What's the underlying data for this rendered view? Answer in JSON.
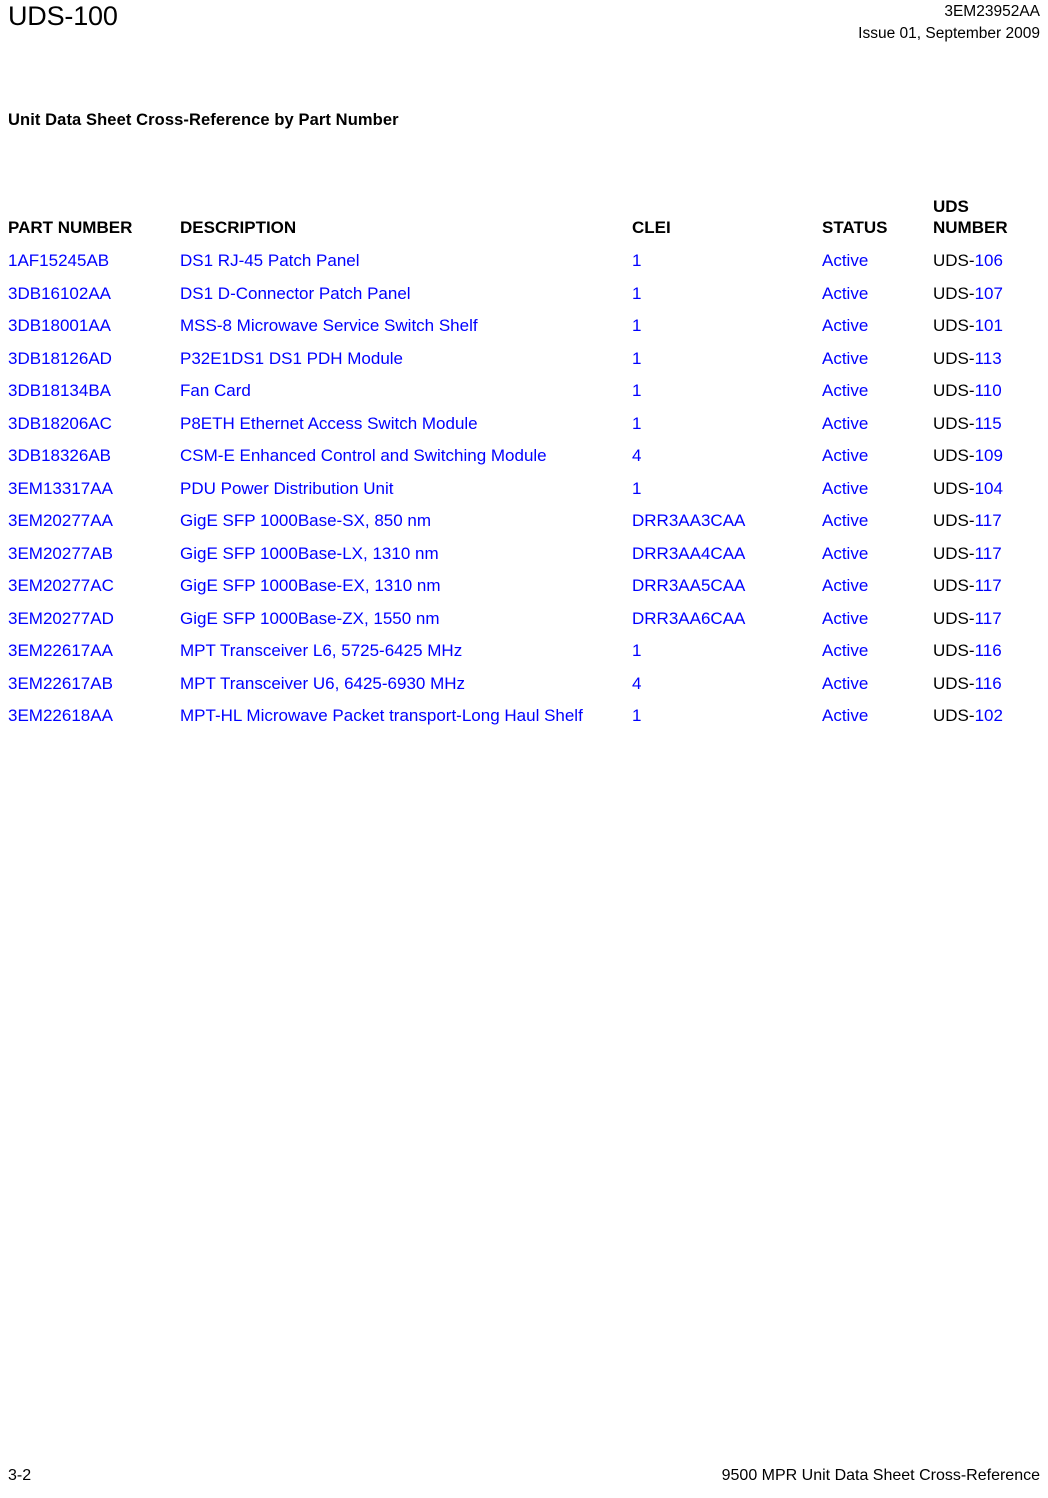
{
  "header": {
    "doc_label": "UDS-100",
    "part_number": "3EM23952AA",
    "issue": "Issue 01, September 2009"
  },
  "section": {
    "title": "Unit Data Sheet Cross-Reference by Part Number"
  },
  "table": {
    "columns": {
      "part_number": "PART NUMBER",
      "description": "DESCRIPTION",
      "clei": "CLEI",
      "status": "STATUS",
      "uds_number": "UDS\nNUMBER"
    },
    "uds_prefix": "UDS-",
    "rows": [
      {
        "part_number": "1AF15245AB",
        "description": "DS1 RJ-45 Patch Panel",
        "clei": "1",
        "status": "Active",
        "uds_number": "106"
      },
      {
        "part_number": "3DB16102AA",
        "description": "DS1 D-Connector Patch Panel",
        "clei": "1",
        "status": "Active",
        "uds_number": "107"
      },
      {
        "part_number": "3DB18001AA",
        "description": "MSS-8 Microwave Service Switch Shelf",
        "clei": "1",
        "status": "Active",
        "uds_number": "101"
      },
      {
        "part_number": "3DB18126AD",
        "description": "P32E1DS1 DS1 PDH Module",
        "clei": "1",
        "status": "Active",
        "uds_number": "113"
      },
      {
        "part_number": "3DB18134BA",
        "description": "Fan Card",
        "clei": "1",
        "status": "Active",
        "uds_number": "110"
      },
      {
        "part_number": "3DB18206AC",
        "description": "P8ETH Ethernet Access Switch Module",
        "clei": "1",
        "status": "Active",
        "uds_number": "115"
      },
      {
        "part_number": "3DB18326AB",
        "description": "CSM-E Enhanced Control and Switching Module",
        "clei": "4",
        "status": "Active",
        "uds_number": "109"
      },
      {
        "part_number": "3EM13317AA",
        "description": "PDU Power Distribution Unit",
        "clei": "1",
        "status": "Active",
        "uds_number": "104"
      },
      {
        "part_number": "3EM20277AA",
        "description": "GigE SFP 1000Base-SX, 850 nm",
        "clei": "DRR3AA3CAA",
        "status": "Active",
        "uds_number": "117"
      },
      {
        "part_number": "3EM20277AB",
        "description": "GigE SFP 1000Base-LX, 1310 nm",
        "clei": "DRR3AA4CAA",
        "status": "Active",
        "uds_number": "117"
      },
      {
        "part_number": "3EM20277AC",
        "description": "GigE SFP 1000Base-EX, 1310 nm",
        "clei": "DRR3AA5CAA",
        "status": "Active",
        "uds_number": "117"
      },
      {
        "part_number": "3EM20277AD",
        "description": "GigE SFP 1000Base-ZX, 1550 nm",
        "clei": "DRR3AA6CAA",
        "status": "Active",
        "uds_number": "117"
      },
      {
        "part_number": "3EM22617AA",
        "description": "MPT Transceiver L6, 5725-6425 MHz",
        "clei": "1",
        "status": "Active",
        "uds_number": "116"
      },
      {
        "part_number": "3EM22617AB",
        "description": "MPT Transceiver U6, 6425-6930 MHz",
        "clei": "4",
        "status": "Active",
        "uds_number": "116"
      },
      {
        "part_number": "3EM22618AA",
        "description": "MPT-HL Microwave Packet transport-Long Haul Shelf",
        "clei": "1",
        "status": "Active",
        "uds_number": "102"
      }
    ]
  },
  "footer": {
    "page_number": "3-2",
    "doc_title": "9500 MPR Unit Data Sheet Cross-Reference"
  },
  "colors": {
    "link_blue": "#0000ff",
    "text_black": "#000000",
    "page_background": "#ffffff"
  }
}
